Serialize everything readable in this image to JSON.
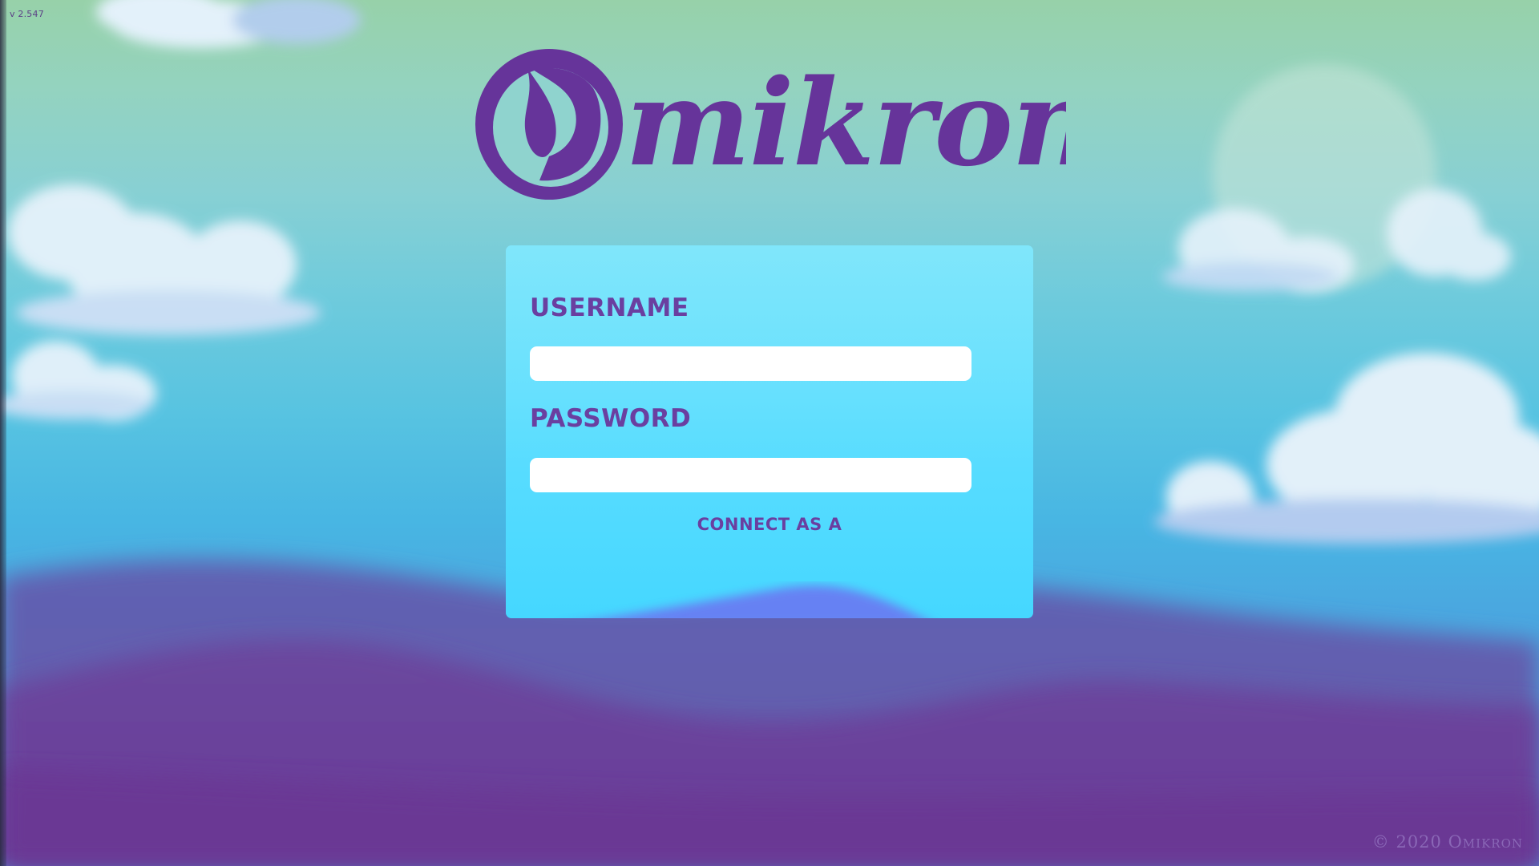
{
  "version": "v 2.547",
  "logo": {
    "text": "Omikron",
    "color": "#66349a"
  },
  "login": {
    "username_label": "Username",
    "username_value": "",
    "password_label": "Password",
    "password_value": "",
    "connect_label": "Connect as a"
  },
  "footer": {
    "copyright": "© 2020 Omikron"
  },
  "colors": {
    "accent_purple": "#6a3fa0",
    "panel_top": "#80e6fb",
    "panel_bottom": "#45d7ff",
    "hill_purple": "#6b3a96"
  }
}
